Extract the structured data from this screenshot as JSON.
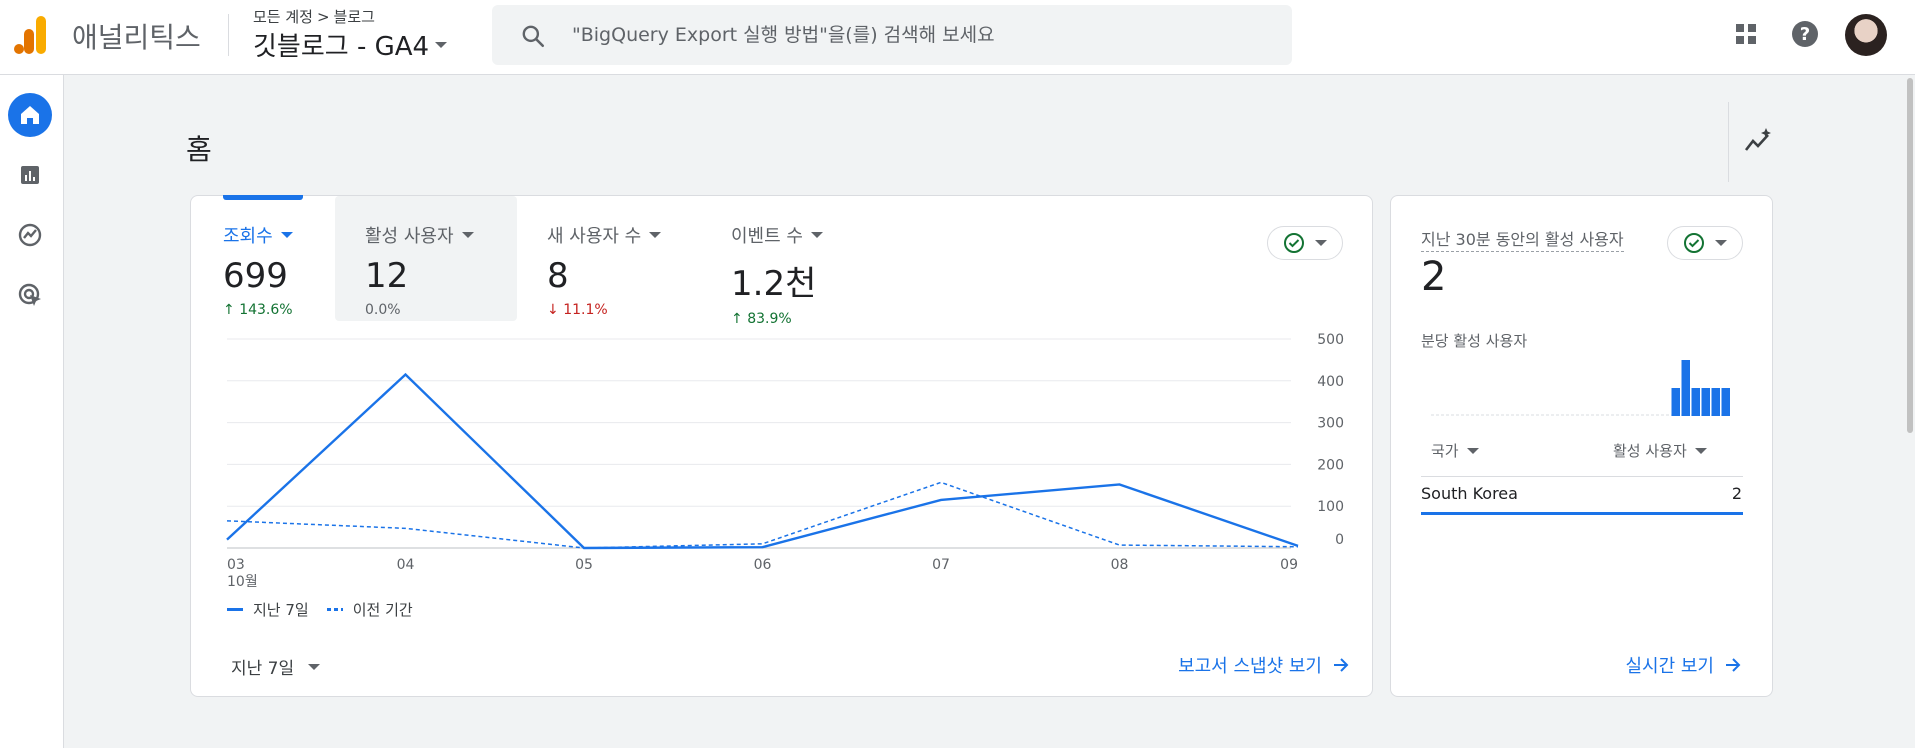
{
  "app": {
    "name": "애널리틱스"
  },
  "breadcrumb": {
    "account": "모든 계정",
    "separator": ">",
    "section": "블로그"
  },
  "property": {
    "name": "깃블로그 - GA4"
  },
  "search": {
    "placeholder": "\"BigQuery Export 실행 방법\"을(를) 검색해 보세요"
  },
  "page": {
    "title": "홈"
  },
  "metrics": [
    {
      "label": "조회수",
      "value": "699",
      "change": "143.6%",
      "direction": "up"
    },
    {
      "label": "활성 사용자",
      "value": "12",
      "change": "0.0%",
      "direction": "flat"
    },
    {
      "label": "새 사용자 수",
      "value": "8",
      "change": "11.1%",
      "direction": "down"
    },
    {
      "label": "이벤트 수",
      "value": "1.2천",
      "change": "83.9%",
      "direction": "up"
    }
  ],
  "chart_data": {
    "type": "line",
    "categories": [
      "03",
      "04",
      "05",
      "06",
      "07",
      "08",
      "09"
    ],
    "x_sublabel": "10월",
    "ylim": [
      0,
      500
    ],
    "yticks": [
      "500",
      "400",
      "300",
      "200",
      "100",
      "0"
    ],
    "series": [
      {
        "name": "지난 7일",
        "style": "solid",
        "values": [
          20,
          415,
          0,
          2,
          115,
          152,
          5
        ]
      },
      {
        "name": "이전 기간",
        "style": "dashed",
        "values": [
          65,
          47,
          0,
          10,
          157,
          7,
          3
        ]
      }
    ],
    "grid": true,
    "legend": "bottom-left"
  },
  "range": {
    "label": "지난 7일"
  },
  "links": {
    "snapshot": "보고서 스냅샷 보기",
    "realtime": "실시간 보기"
  },
  "realtime": {
    "title": "지난 30분 동안의 활성 사용자",
    "value": "2",
    "per_minute_label": "분당 활성 사용자",
    "per_minute_bars": [
      0,
      0,
      0,
      0,
      0,
      0,
      0,
      0,
      0,
      0,
      0,
      0,
      0,
      0,
      0,
      0,
      0,
      0,
      0,
      0,
      0,
      0,
      0,
      0,
      2,
      4,
      2,
      2,
      2,
      2
    ],
    "col_country": "국가",
    "col_users": "활성 사용자",
    "rows": [
      {
        "country": "South Korea",
        "users": "2"
      }
    ]
  },
  "colors": {
    "accent": "#1a73e8",
    "up": "#137333",
    "down": "#c5221f",
    "logo_orange": "#f9ab00",
    "logo_dark": "#e37400"
  }
}
